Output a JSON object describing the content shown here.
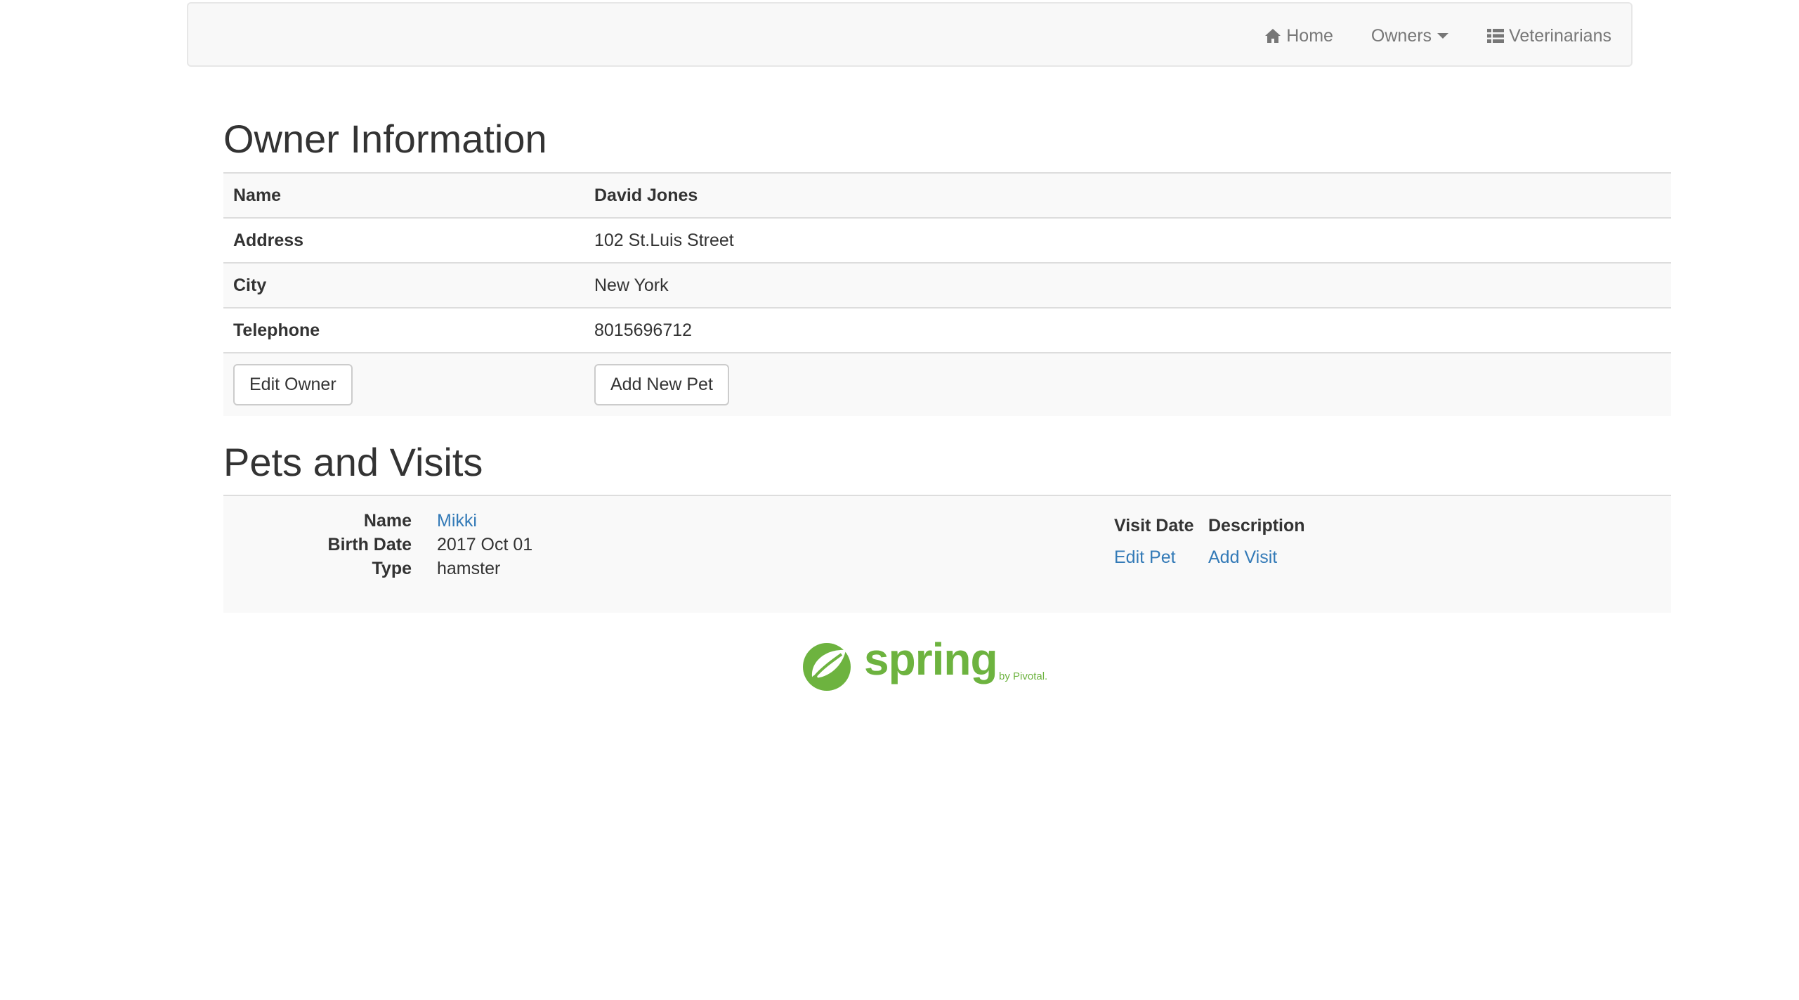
{
  "nav": {
    "home": "Home",
    "owners": "Owners",
    "veterinarians": "Veterinarians"
  },
  "owner": {
    "title": "Owner Information",
    "rows": [
      {
        "label": "Name",
        "value": "David Jones"
      },
      {
        "label": "Address",
        "value": "102 St.Luis Street"
      },
      {
        "label": "City",
        "value": "New York"
      },
      {
        "label": "Telephone",
        "value": "8015696712"
      }
    ],
    "edit_button": "Edit Owner",
    "add_pet_button": "Add New Pet"
  },
  "pets": {
    "title": "Pets and Visits",
    "items": [
      {
        "name_label": "Name",
        "name": "Mikki",
        "birth_label": "Birth Date",
        "birth_date": "2017 Oct 01",
        "type_label": "Type",
        "type": "hamster",
        "visit_date_header": "Visit Date",
        "description_header": "Description",
        "edit_pet": "Edit Pet",
        "add_visit": "Add Visit"
      }
    ]
  },
  "footer": {
    "logo_word": "spring",
    "logo_by": "by Pivotal.",
    "logo_color": "#6db33f"
  },
  "colors": {
    "link": "#337ab7",
    "navbar_bg": "#f8f8f8",
    "stripe": "#f9f9f9"
  }
}
